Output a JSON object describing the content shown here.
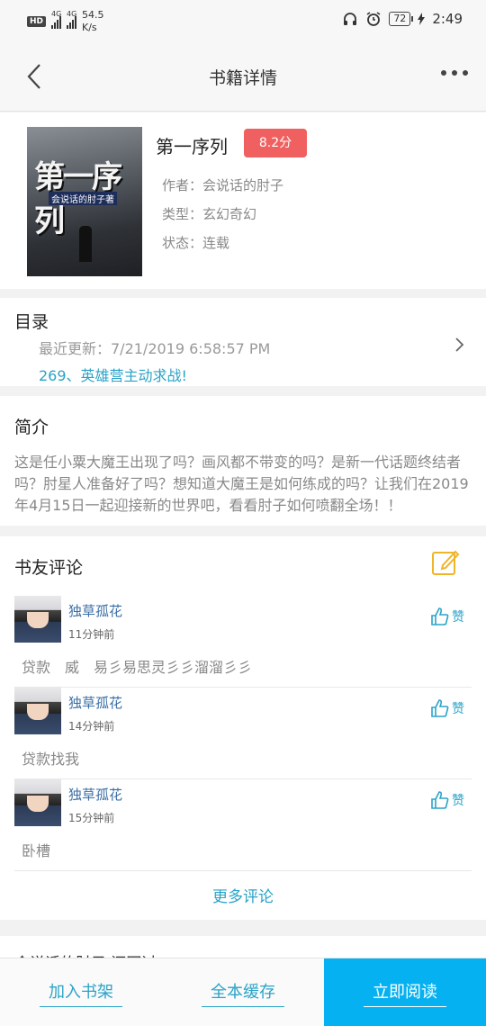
{
  "status_bar": {
    "network_badge": "HD",
    "signal_1": "4G",
    "signal_2": "4G",
    "speed_value": "54.5",
    "speed_unit": "K/s",
    "battery": "72",
    "time": "2:49"
  },
  "nav": {
    "title": "书籍详情"
  },
  "book": {
    "cover_title": "第一序列",
    "cover_subtitle": "会说话的肘子著",
    "title": "第一序列",
    "score": "8.2分",
    "author": "作者：会说话的肘子",
    "genre": "类型：玄幻奇幻",
    "status": "状态：连载"
  },
  "toc": {
    "title": "目录",
    "last_update": "最近更新：7/21/2019 6:58:57 PM",
    "latest_chapter": "269、英雄营主动求战!"
  },
  "intro": {
    "title": "简介",
    "text": "这是任小粟大魔王出现了吗？画风都不带变的吗？是新一代话题终结者吗？肘星人准备好了吗？想知道大魔王是如何练成的吗？让我们在2019年4月15日一起迎接新的世界吧，看看肘子如何喷翻全场！！"
  },
  "reviews": {
    "title": "书友评论",
    "like_label": "赞",
    "items": [
      {
        "name": "独草孤花",
        "time": "11分钟前",
        "text": "贷款　威　易彡易思灵彡彡溜溜彡彡"
      },
      {
        "name": "独草孤花",
        "time": "14分钟前",
        "text": "贷款找我"
      },
      {
        "name": "独草孤花",
        "time": "15分钟前",
        "text": "卧槽"
      }
    ],
    "more": "更多评论"
  },
  "peek": {
    "text": "会说话的肘子 还写过"
  },
  "bottom": {
    "add_shelf": "加入书架",
    "cache_all": "全本缓存",
    "read_now": "立即阅读"
  },
  "colors": {
    "accent": "#2aa3c8",
    "score": "#f06060",
    "read_button": "#05b1f1",
    "like": "#2aa3c8"
  }
}
